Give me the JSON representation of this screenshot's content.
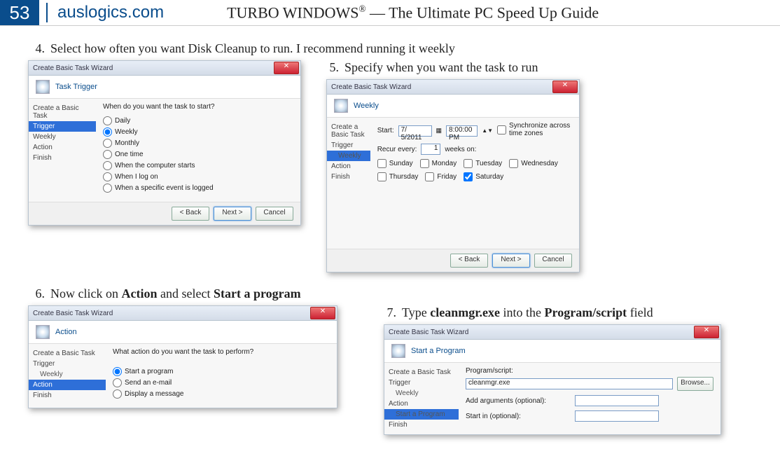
{
  "header": {
    "page_number": "53",
    "site": "auslogics.com",
    "title_prefix": "TURBO WINDOWS",
    "title_suffix": " — The Ultimate PC Speed Up Guide"
  },
  "steps": {
    "s4": {
      "n": "4.",
      "text": "Select how often you want Disk Cleanup to run. I recommend running it weekly"
    },
    "s5": {
      "n": "5.",
      "text": "Specify when you want the task to run"
    },
    "s6": {
      "n": "6.",
      "text_a": "Now click on ",
      "bold_a": "Action",
      "text_b": " and select ",
      "bold_b": "Start a program"
    },
    "s7": {
      "n": "7.",
      "text_a": "Type ",
      "bold_a": "cleanmgr.exe",
      "text_b": " into the ",
      "bold_b": "Program/script",
      "text_c": " field"
    }
  },
  "dialog": {
    "title": "Create Basic Task Wizard",
    "sidebar": {
      "create_task": "Create a Basic Task",
      "trigger": "Trigger",
      "weekly": "Weekly",
      "action": "Action",
      "start_program": "Start a Program",
      "finish": "Finish"
    },
    "buttons": {
      "back": "< Back",
      "next": "Next >",
      "cancel": "Cancel",
      "browse": "Browse..."
    }
  },
  "d1": {
    "header": "Task Trigger",
    "question": "When do you want the task to start?",
    "opts": {
      "daily": "Daily",
      "weekly": "Weekly",
      "monthly": "Monthly",
      "one_time": "One time",
      "computer_starts": "When the computer starts",
      "log_on": "When I log on",
      "specific_event": "When a specific event is logged"
    }
  },
  "d2": {
    "header": "Weekly",
    "start_label": "Start:",
    "start_date": "7/ 5/2011",
    "start_time": "8:00:00 PM",
    "sync": "Synchronize across time zones",
    "recur_a": "Recur every:",
    "recur_val": "1",
    "recur_b": "weeks on:",
    "days": {
      "sun": "Sunday",
      "mon": "Monday",
      "tue": "Tuesday",
      "wed": "Wednesday",
      "thu": "Thursday",
      "fri": "Friday",
      "sat": "Saturday"
    }
  },
  "d3": {
    "header": "Action",
    "question": "What action do you want the task to perform?",
    "opts": {
      "start_program": "Start a program",
      "send_email": "Send an e-mail",
      "display_message": "Display a message"
    }
  },
  "d4": {
    "header": "Start a Program",
    "program_label": "Program/script:",
    "program_value": "cleanmgr.exe",
    "args_label": "Add arguments (optional):",
    "startin_label": "Start in (optional):"
  }
}
